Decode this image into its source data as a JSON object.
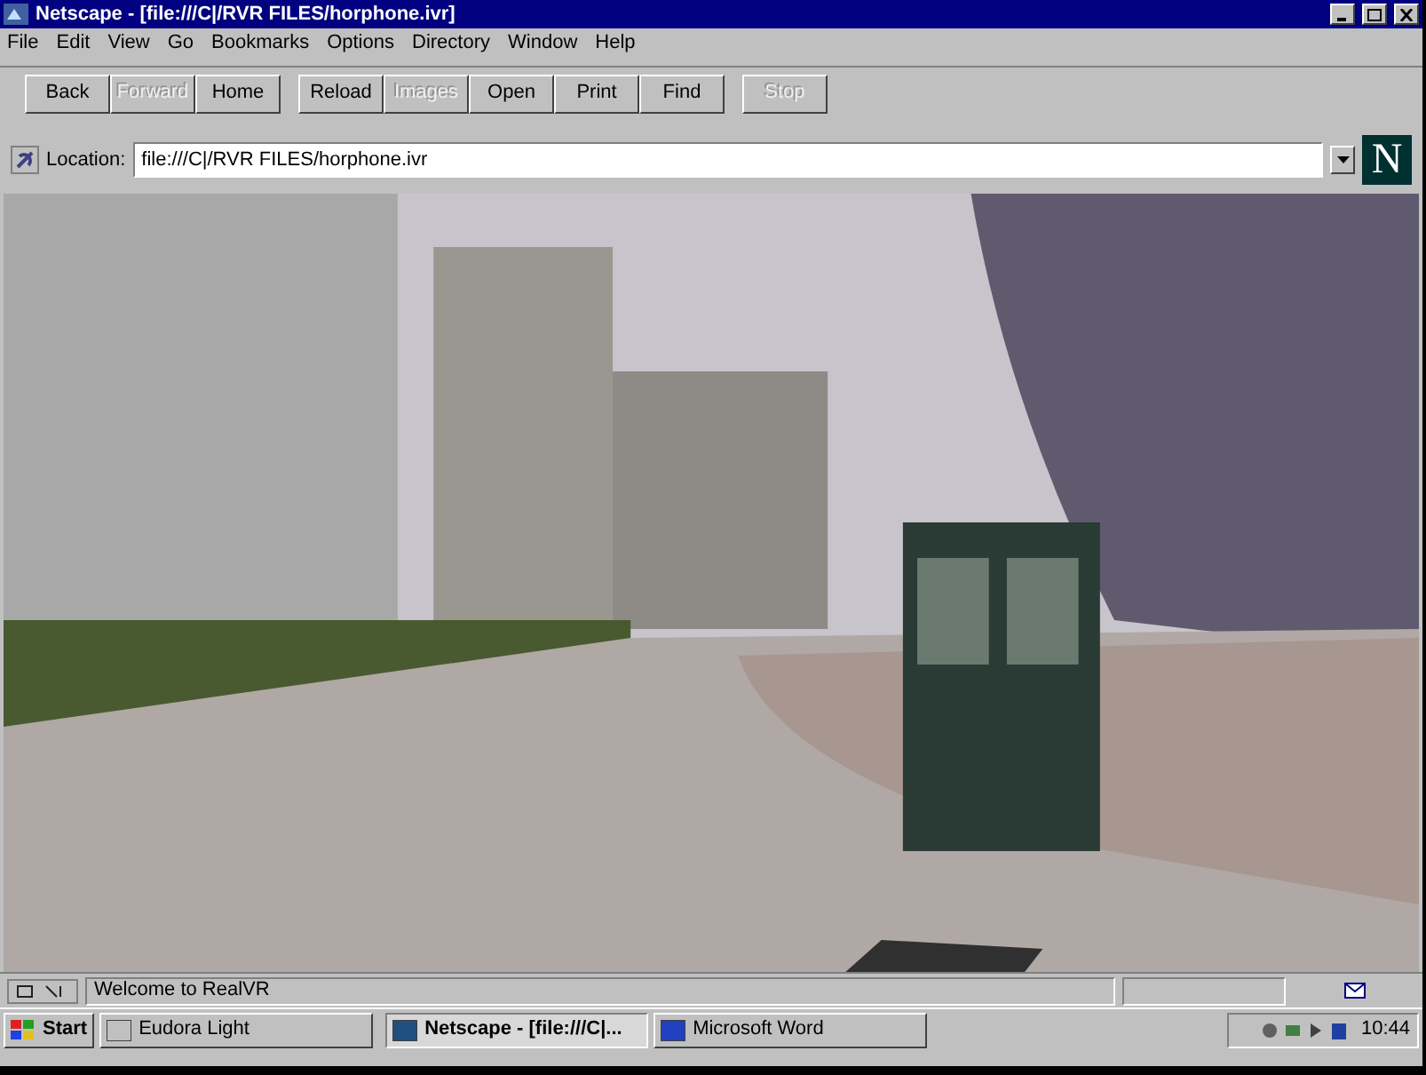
{
  "window": {
    "title": "Netscape - [file:///C|/RVR FILES/horphone.ivr]"
  },
  "menu": [
    "File",
    "Edit",
    "View",
    "Go",
    "Bookmarks",
    "Options",
    "Directory",
    "Window",
    "Help"
  ],
  "toolbar": [
    {
      "label": "Back",
      "disabled": false
    },
    {
      "label": "Forward",
      "disabled": true
    },
    {
      "label": "Home",
      "disabled": false
    },
    {
      "label": "Reload",
      "disabled": false
    },
    {
      "label": "Images",
      "disabled": true
    },
    {
      "label": "Open",
      "disabled": false
    },
    {
      "label": "Print",
      "disabled": false
    },
    {
      "label": "Find",
      "disabled": false
    },
    {
      "label": "Stop",
      "disabled": true
    }
  ],
  "location": {
    "label": "Location:",
    "value": "file:///C|/RVR FILES/horphone.ivr"
  },
  "logo": "N",
  "status_bar": {
    "text": "Welcome to RealVR"
  },
  "taskbar": {
    "start": "Start",
    "tasks": [
      {
        "label": "Eudora Light",
        "selected": false
      },
      {
        "label": "Netscape - [file:///C|...",
        "selected": true
      },
      {
        "label": "Microsoft Word",
        "selected": false
      }
    ],
    "clock": "10:44"
  }
}
